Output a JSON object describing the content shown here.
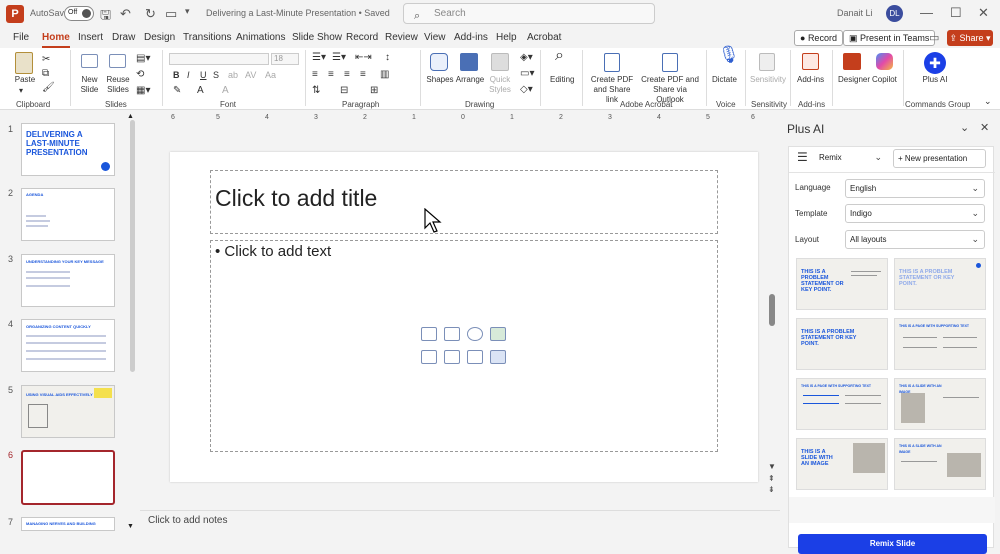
{
  "titlebar": {
    "app_logo": "P",
    "autosave_label": "AutoSave",
    "toggle_state": "Off",
    "doc_title": "Delivering a Last-Minute Presentation • Saved",
    "search_placeholder": "Search",
    "user_name": "Danait Li",
    "user_initials": "DL"
  },
  "menu": {
    "tabs": [
      "File",
      "Home",
      "Insert",
      "Draw",
      "Design",
      "Transitions",
      "Animations",
      "Slide Show",
      "Record",
      "Review",
      "View",
      "Add-ins",
      "Help",
      "Acrobat"
    ],
    "record_label": "Record",
    "present_label": "Present in Teams",
    "share_label": "Share"
  },
  "ribbon": {
    "paste": "Paste",
    "new_slide": "New Slide",
    "reuse_slides": "Reuse Slides",
    "font_size": "18",
    "shapes": "Shapes",
    "arrange": "Arrange",
    "quick_styles": "Quick Styles",
    "editing": "Editing",
    "create_pdf_share": "Create PDF and Share link",
    "create_pdf_outlook": "Create PDF and Share via Outlook",
    "dictate": "Dictate",
    "sensitivity": "Sensitivity",
    "addins": "Add-ins",
    "designer": "Designer",
    "copilot": "Copilot",
    "plus_ai": "Plus AI",
    "groups": [
      "Clipboard",
      "Slides",
      "Font",
      "Paragraph",
      "Drawing",
      "Adobe Acrobat",
      "Voice",
      "Sensitivity",
      "Add-ins",
      "Commands Group"
    ]
  },
  "thumbnails": [
    {
      "num": "1",
      "title": "DELIVERING A LAST-MINUTE PRESENTATION"
    },
    {
      "num": "2",
      "title": "AGENDA"
    },
    {
      "num": "3",
      "title": "UNDERSTANDING YOUR KEY MESSAGE"
    },
    {
      "num": "4",
      "title": "ORGANIZING CONTENT QUICKLY"
    },
    {
      "num": "5",
      "title": "USING VISUAL AIDS EFFECTIVELY"
    },
    {
      "num": "6",
      "title": ""
    },
    {
      "num": "7",
      "title": "MANAGING NERVES AND BUILDING CONFIDENCE"
    }
  ],
  "slide": {
    "title_placeholder": "Click to add title",
    "body_placeholder": "• Click to add text"
  },
  "notes_placeholder": "Click to add notes",
  "ruler_marks": [
    "6",
    "5",
    "4",
    "3",
    "2",
    "1",
    "0",
    "1",
    "2",
    "3",
    "4",
    "5",
    "6"
  ],
  "panel": {
    "title": "Plus AI",
    "mode": "Remix",
    "new_presentation": "+ New presentation",
    "language_label": "Language",
    "language_value": "English",
    "template_label": "Template",
    "template_value": "Indigo",
    "layout_label": "Layout",
    "layout_value": "All layouts",
    "templates": [
      {
        "title": "THIS IS A PROBLEM STATEMENT OR KEY POINT."
      },
      {
        "title": "THIS IS A PROBLEM STATEMENT OR KEY POINT."
      },
      {
        "title": "THIS IS A PROBLEM STATEMENT OR KEY POINT."
      },
      {
        "title": "THIS IS A PAGE WITH SUPPORTING TEXT"
      },
      {
        "title": "THIS IS A PAGE WITH SUPPORTING TEXT"
      },
      {
        "title": "THIS IS A SLIDE WITH AN IMAGE"
      },
      {
        "title": "THIS IS A SLIDE WITH AN IMAGE"
      },
      {
        "title": "THIS IS A SLIDE WITH AN IMAGE"
      }
    ],
    "remix_button": "Remix Slide"
  },
  "colors": {
    "accent": "#c43e1c",
    "selection": "#a4262c",
    "plus_blue": "#1b3fe6",
    "thumb_blue": "#1a56db"
  }
}
